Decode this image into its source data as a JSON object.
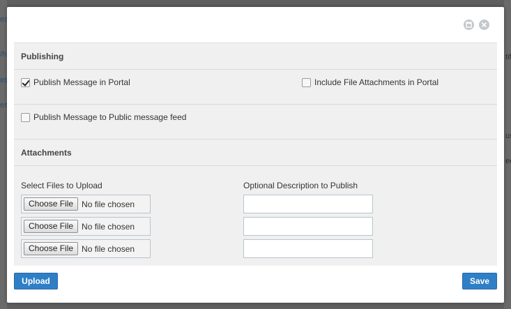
{
  "background": {
    "left_fragments": [
      "es",
      "/h",
      "es",
      "es"
    ],
    "right_fragments": [
      "tifi",
      "us",
      "ee"
    ]
  },
  "window_controls": {
    "maximize_icon": "maximize-icon",
    "close_icon": "close-icon"
  },
  "publishing": {
    "heading": "Publishing",
    "publish_portal": {
      "label": "Publish Message in Portal",
      "checked": true
    },
    "include_attachments": {
      "label": "Include File Attachments in Portal",
      "checked": false
    },
    "publish_public_feed": {
      "label": "Publish Message to Public message feed",
      "checked": false
    }
  },
  "attachments": {
    "heading": "Attachments",
    "files_label": "Select Files to Upload",
    "description_label": "Optional Description to Publish",
    "rows": [
      {
        "button": "Choose File",
        "status": "No file chosen",
        "description": ""
      },
      {
        "button": "Choose File",
        "status": "No file chosen",
        "description": ""
      },
      {
        "button": "Choose File",
        "status": "No file chosen",
        "description": ""
      }
    ]
  },
  "footer": {
    "upload_label": "Upload",
    "save_label": "Save"
  },
  "colors": {
    "primary_button": "#2f7fc6",
    "overlay": "#5f5f5f",
    "panel": "#f0f0f0"
  }
}
